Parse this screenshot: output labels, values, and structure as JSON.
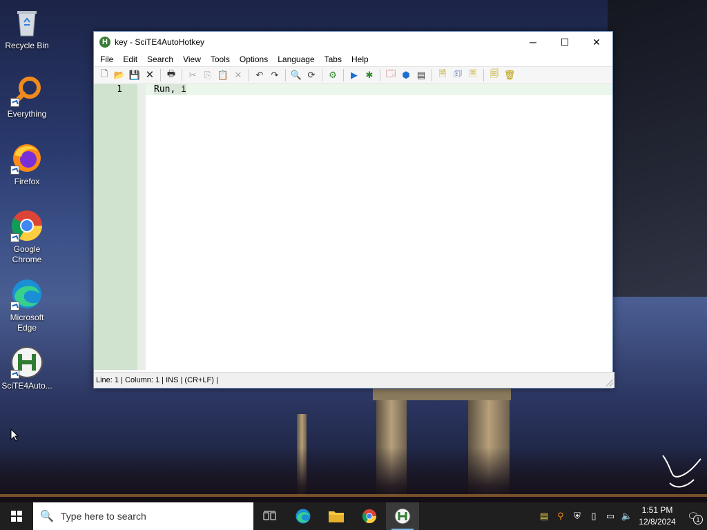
{
  "desktop": {
    "icons": [
      {
        "label": "Recycle Bin"
      },
      {
        "label": "Everything"
      },
      {
        "label": "Firefox"
      },
      {
        "label": "Google Chrome"
      },
      {
        "label": "Microsoft Edge"
      },
      {
        "label": "SciTE4Auto..."
      }
    ]
  },
  "window": {
    "title": "key - SciTE4AutoHotkey",
    "app_icon_letter": "H",
    "controls": {
      "minimize": "─",
      "maximize": "☐",
      "close": "✕"
    },
    "menu": [
      "File",
      "Edit",
      "Search",
      "View",
      "Tools",
      "Options",
      "Language",
      "Tabs",
      "Help"
    ],
    "toolbar": {
      "new": "🗋",
      "open": "📂",
      "save": "💾",
      "close": "🗙",
      "print": "🖶",
      "cut": "✂",
      "copy": "⎘",
      "paste": "📋",
      "delete": "✕",
      "undo": "↶",
      "redo": "↷",
      "find": "🔍",
      "replace": "⟳",
      "compile": "⚙",
      "run": "▶",
      "debug": "✱",
      "tool1": "🗔",
      "tool2": "⬢",
      "tool3": "▤",
      "tool4": "🗎",
      "tool5": "🗊",
      "tool6": "🗏",
      "tool7": "🗐",
      "tool8": "🗑"
    },
    "editor": {
      "line_number": "1",
      "code_selected": "Run, i",
      "code_rest": ""
    },
    "status": "Line: 1 | Column: 1 | INS | (CR+LF) |"
  },
  "taskbar": {
    "search_placeholder": "Type here to search",
    "search_icon": "🔍",
    "apps": [
      {
        "name": "task-view",
        "glyph": "⧉"
      },
      {
        "name": "edge",
        "glyph": "e"
      },
      {
        "name": "file-explorer",
        "glyph": "📁"
      },
      {
        "name": "chrome",
        "glyph": "◉"
      },
      {
        "name": "scite",
        "glyph": "H"
      }
    ],
    "clock": {
      "time": "1:51 PM",
      "date": "12/8/2024"
    },
    "notification_count": "1"
  }
}
